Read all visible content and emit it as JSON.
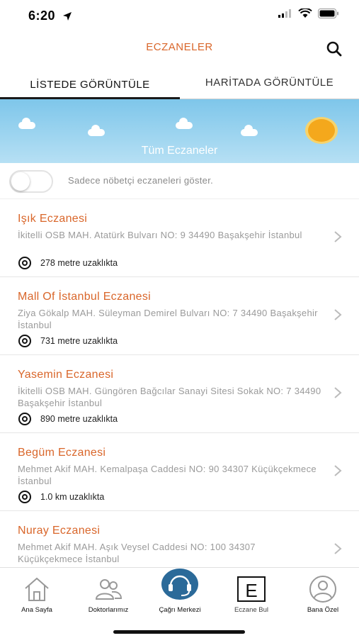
{
  "status_bar": {
    "time": "6:20"
  },
  "header": {
    "title": "ECZANELER"
  },
  "tabs": [
    {
      "label": "LİSTEDE GÖRÜNTÜLE"
    },
    {
      "label": "HARİTADA GÖRÜNTÜLE"
    }
  ],
  "banner": {
    "label": "Tüm Eczaneler"
  },
  "filter": {
    "label": "Sadece nöbetçi eczaneleri göster."
  },
  "pharmacies": [
    {
      "name": "Işık Eczanesi",
      "address": "İkitelli OSB MAH. Atatürk Bulvarı NO: 9 34490 Başakşehir İstanbul",
      "distance": "278 metre uzaklıkta"
    },
    {
      "name": "Mall Of İstanbul Eczanesi",
      "address": "Ziya Gökalp MAH. Süleyman Demirel Bulvarı NO: 7 34490 Başakşehir İstanbul",
      "distance": "731 metre uzaklıkta"
    },
    {
      "name": "Yasemin Eczanesi",
      "address": "İkitelli OSB MAH. Güngören Bağcılar Sanayi Sitesi Sokak NO: 7 34490 Başakşehir İstanbul",
      "distance": "890 metre uzaklıkta"
    },
    {
      "name": "Begüm Eczanesi",
      "address": "Mehmet Akif MAH. Kemalpaşa Caddesi NO: 90 34307 Küçükçekmece İstanbul",
      "distance": "1.0 km uzaklıkta"
    },
    {
      "name": "Nuray Eczanesi",
      "address": "Mehmet Akif MAH. Aşık Veysel Caddesi NO: 100 34307 Küçükçekmece İstanbul",
      "distance": ""
    }
  ],
  "tab_bar": [
    {
      "label": "Ana Sayfa",
      "icon": "home-icon"
    },
    {
      "label": "Doktorlarımız",
      "icon": "doctors-icon"
    },
    {
      "label": "Çağrı Merkezi",
      "icon": "headset-icon"
    },
    {
      "label": "Eczane Bul",
      "icon": "pharmacy-e-icon"
    },
    {
      "label": "Bana Özel",
      "icon": "profile-icon"
    }
  ],
  "colors": {
    "accent": "#d9662a",
    "sky_top": "#7ec6ea",
    "sky_bottom": "#b6e0f4",
    "sun": "#f4a81c",
    "call_center": "#2b6a99"
  }
}
